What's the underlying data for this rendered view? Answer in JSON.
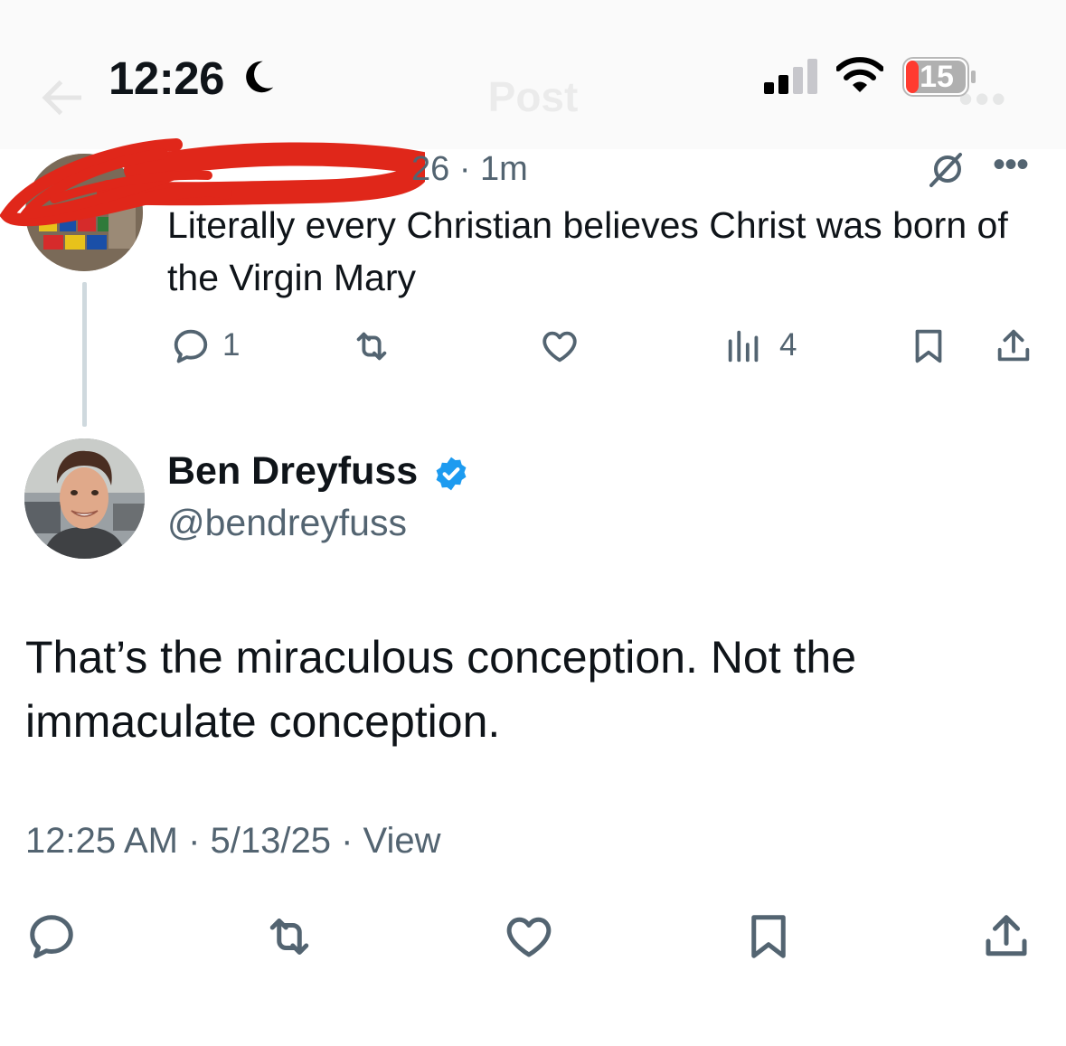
{
  "app": {
    "header_title": "Post"
  },
  "status_bar": {
    "time": "12:26",
    "battery_level": "15",
    "focus_mode_icon": "moon-icon",
    "signal_bars_filled": 2,
    "signal_bars_total": 4,
    "colors": {
      "battery_low": "#ff3b30"
    }
  },
  "parent_tweet": {
    "meta_visible": "26 · 1m",
    "text": "Literally every Christian believes Christ was born of the Virgin Mary",
    "actions": {
      "reply_count": "1",
      "views_count": "4"
    }
  },
  "main_tweet": {
    "display_name": "Ben Dreyfuss",
    "handle": "@bendreyfuss",
    "verified": true,
    "text": "That’s the miraculous conception. Not the immaculate conception.",
    "timestamp_line": "12:25 AM · 5/13/25 · View"
  },
  "theme": {
    "text_primary": "#0f1419",
    "text_secondary": "#536471",
    "accent_blue": "#1d9bf0",
    "redaction_red": "#e0271a",
    "thread_line": "#cfd9de"
  }
}
